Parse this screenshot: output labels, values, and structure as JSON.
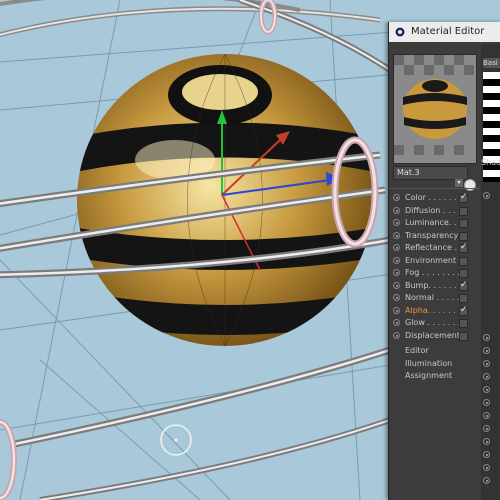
{
  "window": {
    "title": "Material Editor"
  },
  "material": {
    "name": "Mat.3"
  },
  "right_column": {
    "tab_label": "Basi",
    "section_label": "Shad"
  },
  "channels": [
    {
      "label": "Color . . . . . . .",
      "checked": true,
      "active": false
    },
    {
      "label": "Diffusion . . . .",
      "checked": false,
      "active": false
    },
    {
      "label": "Luminance. . .",
      "checked": false,
      "active": false
    },
    {
      "label": "Transparency",
      "checked": false,
      "active": false
    },
    {
      "label": "Reflectance . .",
      "checked": true,
      "active": false
    },
    {
      "label": "Environment",
      "checked": false,
      "active": false
    },
    {
      "label": "Fog . . . . . . . .",
      "checked": false,
      "active": false
    },
    {
      "label": "Bump. . . . . . .",
      "checked": true,
      "active": false
    },
    {
      "label": "Normal . . . . . .",
      "checked": false,
      "active": false
    },
    {
      "label": "Alpha. . . . . . .",
      "checked": true,
      "active": true
    },
    {
      "label": "Glow . . . . . . .",
      "checked": false,
      "active": false
    },
    {
      "label": "Displacement",
      "checked": false,
      "active": false
    }
  ],
  "extra_items": [
    "Editor",
    "Illumination",
    "Assignment"
  ],
  "icons": {
    "app": "cinema4d-logo-icon",
    "gear": "gear-icon",
    "dropdown": "chevron-down-icon"
  },
  "colors": {
    "alpha_active": "#e39a3a",
    "viewport_bg": "#a9c9da",
    "panel_bg": "#3c3c3c"
  }
}
